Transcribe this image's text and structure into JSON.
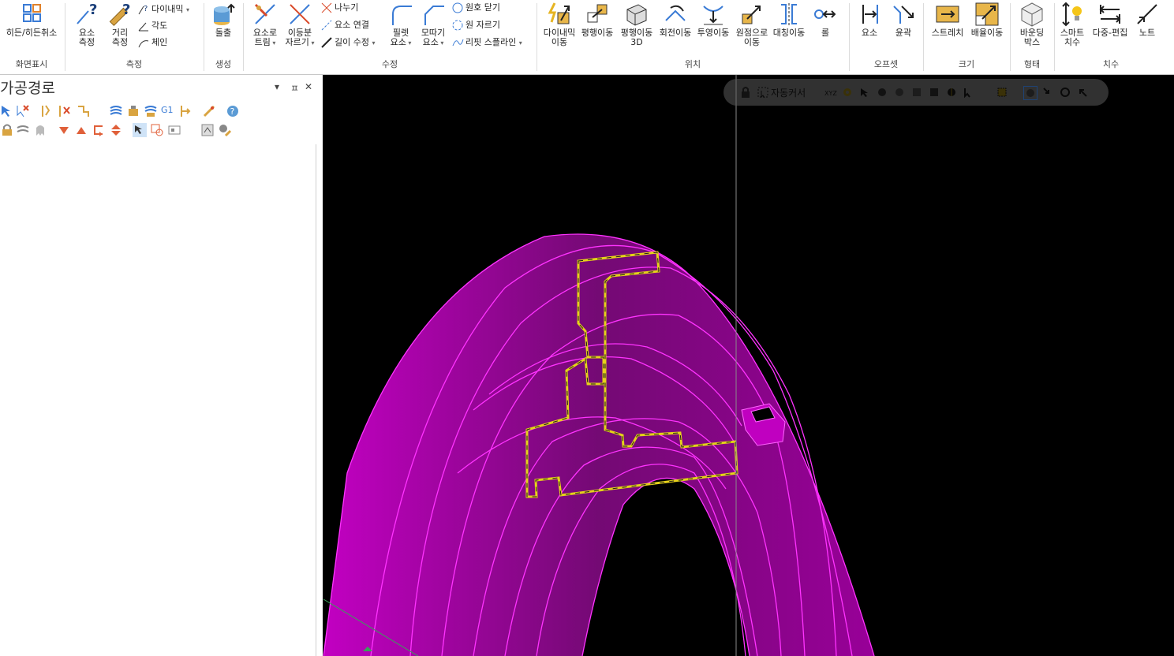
{
  "ribbon": {
    "groups": {
      "display": "화면표시",
      "measure": "측정",
      "create": "생성",
      "modify": "수정",
      "position": "위치",
      "offset": "오프셋",
      "size": "크기",
      "shape": "형태",
      "dimension": "치수"
    },
    "buttons": {
      "hide_unhide": "히든/히든취소",
      "measure_entity": "요소\n측정",
      "measure_distance": "거리\n측정",
      "dynamic": "다이내믹",
      "angle": "각도",
      "chain": "체인",
      "extrude": "돌출",
      "trim_to_entity": "요소로\n트림",
      "divide_trim": "이등분\n자르기",
      "break": "나누기",
      "join_entities": "요소 연결",
      "modify_length": "길이 수정",
      "fillet_entities": "필렛\n요소",
      "chamfer_entities": "모따기\n요소",
      "close_arc": "원호 닫기",
      "break_circle": "원 자르기",
      "respline": "리핏 스플라인",
      "dynamic_move": "다이내믹\n이동",
      "translate": "평행이동",
      "translate_3d": "평행이동\n3D",
      "rotate": "회전이동",
      "project": "투영이동",
      "move_to_origin": "원점으로\n이동",
      "mirror": "대칭이동",
      "roll": "롤",
      "offset_entity": "요소",
      "offset_contour": "윤곽",
      "stretch": "스트레치",
      "scale": "배율이동",
      "bounding_box": "바운딩\n박스",
      "smart_dimension": "스마트\n치수",
      "multi_edit": "다중-편집",
      "note": "노트"
    }
  },
  "panel": {
    "title": "가공경로",
    "menu_icon": "▾",
    "pin_icon": "ㅍ",
    "close_icon": "✕",
    "g1_label": "G1"
  },
  "viewport": {
    "toolbar_label": "자동커서",
    "xyz_label": "XYZ"
  },
  "colors": {
    "ribbon_bg": "#ffffff",
    "viewport_bg": "#000000",
    "wireframe": "#e600e6",
    "chain_highlight": "#e6d21a"
  }
}
